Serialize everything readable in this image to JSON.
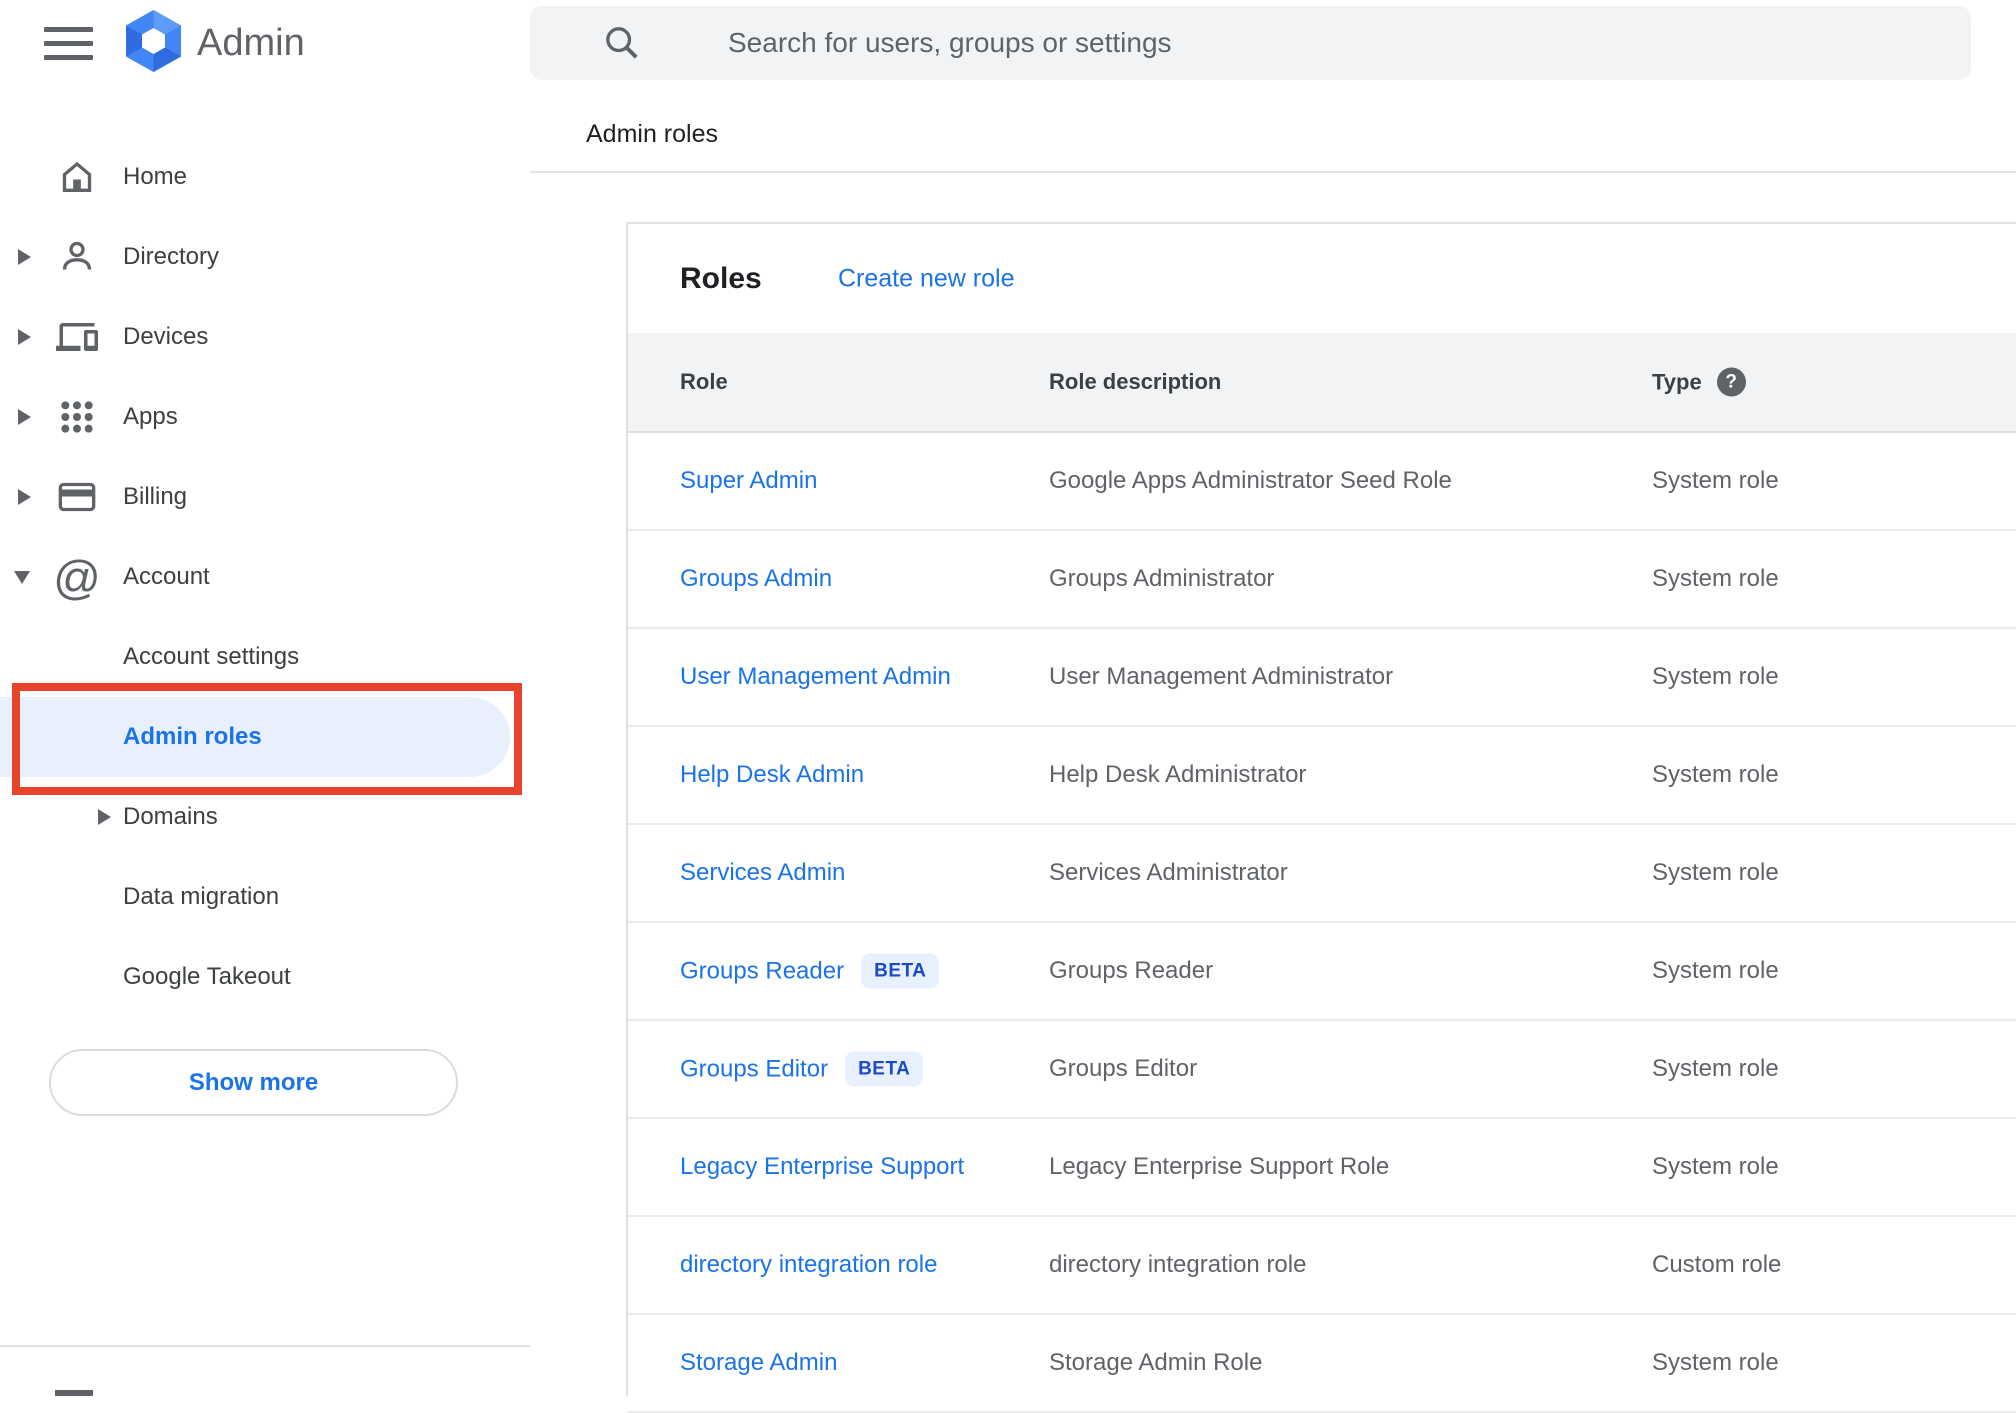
{
  "app": {
    "title": "Admin"
  },
  "search": {
    "placeholder": "Search for users, groups or settings"
  },
  "breadcrumb": "Admin roles",
  "sidebar": {
    "items": [
      {
        "label": "Home",
        "icon": "home-icon"
      },
      {
        "label": "Directory",
        "icon": "person-icon",
        "caret": "right"
      },
      {
        "label": "Devices",
        "icon": "devices-icon",
        "caret": "right"
      },
      {
        "label": "Apps",
        "icon": "apps-icon",
        "caret": "right"
      },
      {
        "label": "Billing",
        "icon": "billing-icon",
        "caret": "right"
      },
      {
        "label": "Account",
        "icon": "at-icon",
        "caret": "down"
      },
      {
        "label": "Account settings",
        "sub": true
      },
      {
        "label": "Admin roles",
        "sub": true,
        "selected": true,
        "annotated": true
      },
      {
        "label": "Domains",
        "sub": true,
        "caret": "right"
      },
      {
        "label": "Data migration",
        "sub": true
      },
      {
        "label": "Google Takeout",
        "sub": true
      }
    ],
    "show_more_label": "Show more"
  },
  "roles_card": {
    "title": "Roles",
    "create_link": "Create new role",
    "columns": {
      "role": "Role",
      "description": "Role description",
      "type": "Type"
    },
    "beta_label": "BETA",
    "rows": [
      {
        "role": "Super Admin",
        "beta": false,
        "description": "Google Apps Administrator Seed Role",
        "type": "System role"
      },
      {
        "role": "Groups Admin",
        "beta": false,
        "description": "Groups Administrator",
        "type": "System role"
      },
      {
        "role": "User Management Admin",
        "beta": false,
        "description": "User Management Administrator",
        "type": "System role"
      },
      {
        "role": "Help Desk Admin",
        "beta": false,
        "description": "Help Desk Administrator",
        "type": "System role"
      },
      {
        "role": "Services Admin",
        "beta": false,
        "description": "Services Administrator",
        "type": "System role"
      },
      {
        "role": "Groups Reader",
        "beta": true,
        "description": "Groups Reader",
        "type": "System role"
      },
      {
        "role": "Groups Editor",
        "beta": true,
        "description": "Groups Editor",
        "type": "System role"
      },
      {
        "role": "Legacy Enterprise Support",
        "beta": false,
        "description": "Legacy Enterprise Support Role",
        "type": "System role"
      },
      {
        "role": "directory integration role",
        "beta": false,
        "description": "directory integration role",
        "type": "Custom role"
      },
      {
        "role": "Storage Admin",
        "beta": false,
        "description": "Storage Admin Role",
        "type": "System role"
      }
    ]
  },
  "colors": {
    "accent_blue": "#1a73e8",
    "highlight_blue": "#e8f0fe",
    "annotation_red": "#e8442c",
    "beta_text_blue": "#1b4ac5",
    "header_gray": "#f1f3f4",
    "text_gray": "#5f6368"
  }
}
